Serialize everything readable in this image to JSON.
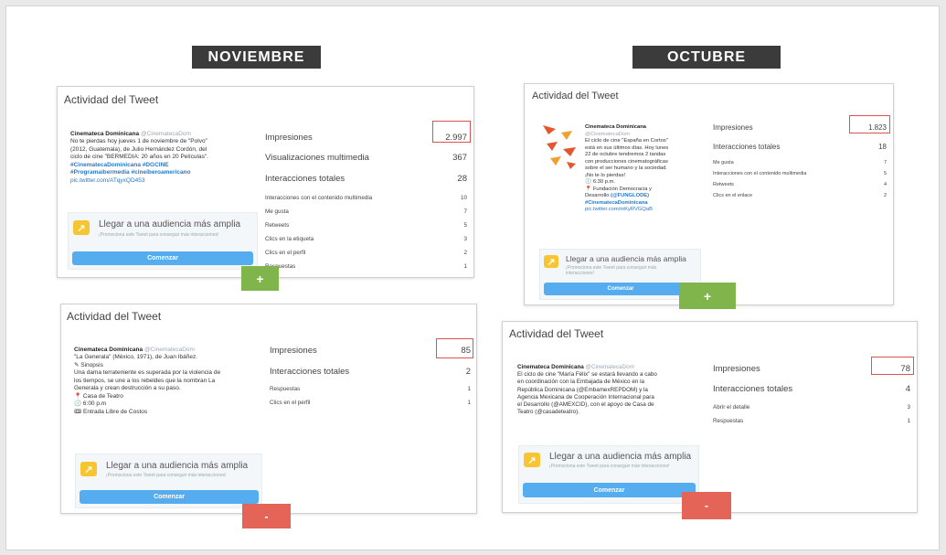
{
  "banners": {
    "left": "NOVIEMBRE",
    "right": "OCTUBRE"
  },
  "common": {
    "card_title": "Actividad del Tweet",
    "promo_title": "Llegar a una audiencia más amplia",
    "promo_sub": "¡Promociona este Tweet para conseguir más interacciones!",
    "button": "Comenzar",
    "plus": "+",
    "minus": "-"
  },
  "cards": {
    "nov_top": {
      "author": "Cinemateca Dominicana",
      "handle": "@CinematecaDom",
      "lines": [
        "No te pierdas hoy jueves 1 de noviembre de \"Polvo\"",
        "(2012, Guatemala), de Julio Hernández Cordón, del",
        "ciclo de cine \"BERMEDIA: 20 años en 20  Películas\"."
      ],
      "tags": [
        "#CinematecaDominicana #DGCINE",
        "#Programaibermedia #cineiberoamericano"
      ],
      "link": "pic.twitter.com/ATqyxQD453",
      "metrics": [
        {
          "label": "Impresiones",
          "value": "2.997"
        },
        {
          "label": "Visualizaciones multimedia",
          "value": "367"
        },
        {
          "label": "Interacciones totales",
          "value": "28"
        },
        {
          "label": "Interacciones con el contenido multimedia",
          "value": "10"
        },
        {
          "label": "Me gusta",
          "value": "7"
        },
        {
          "label": "Retweets",
          "value": "5"
        },
        {
          "label": "Clics en la etiqueta",
          "value": "3"
        },
        {
          "label": "Clics en el perfil",
          "value": "2"
        },
        {
          "label": "Respuestas",
          "value": "1"
        }
      ]
    },
    "nov_bottom": {
      "author": "Cinemateca Dominicana",
      "handle": "@CinematecaDom",
      "lines": [
        "\"La Generala\" (México, 1971), de Juan Ibáñez.",
        "✎ Sinopsis",
        "Una dama terrateniente es superada por la violencia de",
        "los tiempos, se une a los rebeldes que la nombran La",
        "Generala y crean destrucción a su paso.",
        "📍 Casa de Teatro",
        "🕕 6:00 p.m",
        "🎟 Entrada Libre de Costos"
      ],
      "metrics": [
        {
          "label": "Impresiones",
          "value": "85"
        },
        {
          "label": "Interacciones totales",
          "value": "2"
        },
        {
          "label": "Respuestas",
          "value": "1"
        },
        {
          "label": "Clics en el perfil",
          "value": "1"
        }
      ]
    },
    "oct_top": {
      "author": "Cinemateca Dominicana",
      "handle": "@CinematecaDom",
      "lines": [
        "El ciclo de cine \"España en Cortos\"",
        "está en sus últimos días. Hoy lunes",
        "22 de octubre tendremos 2 tandas",
        "con producciones cinematográficas",
        "sobre el ser humano y la sociedad.",
        "¡No te lo pierdas!",
        "🕕 6:30 p.m.",
        "📍 Fundación Democracia y",
        "Desarrollo"
      ],
      "mention": "(@FUNGLODE)",
      "tags": [
        "#CinematecaDominicana"
      ],
      "link": "pic.twitter.com/mKyRVGQaB",
      "metrics": [
        {
          "label": "Impresiones",
          "value": "1.823"
        },
        {
          "label": "Interacciones totales",
          "value": "18"
        },
        {
          "label": "Me gusta",
          "value": "7"
        },
        {
          "label": "Interacciones con el contenido multimedia",
          "value": "5"
        },
        {
          "label": "Retweets",
          "value": "4"
        },
        {
          "label": "Clics en el enlace",
          "value": "2"
        }
      ]
    },
    "oct_bottom": {
      "author": "Cinemateca Dominicana",
      "handle": "@CinematecaDom",
      "lines": [
        "El ciclo de cine \"María Félix\" se estará llevando a cabo",
        "en coordinación con la Embajada de México en la",
        "República Dominicana (@EmbamexREPDOM) y la",
        "Agencia Mexicana de Cooperación Internacional para",
        "el Desarrollo (@AMEXCID), con el apoyo de Casa de",
        "Teatro (@casadeteatro)."
      ],
      "metrics": [
        {
          "label": "Impresiones",
          "value": "78"
        },
        {
          "label": "Interacciones totales",
          "value": "4"
        },
        {
          "label": "Abrir el detalle",
          "value": "3"
        },
        {
          "label": "Respuestas",
          "value": "1"
        }
      ]
    }
  }
}
